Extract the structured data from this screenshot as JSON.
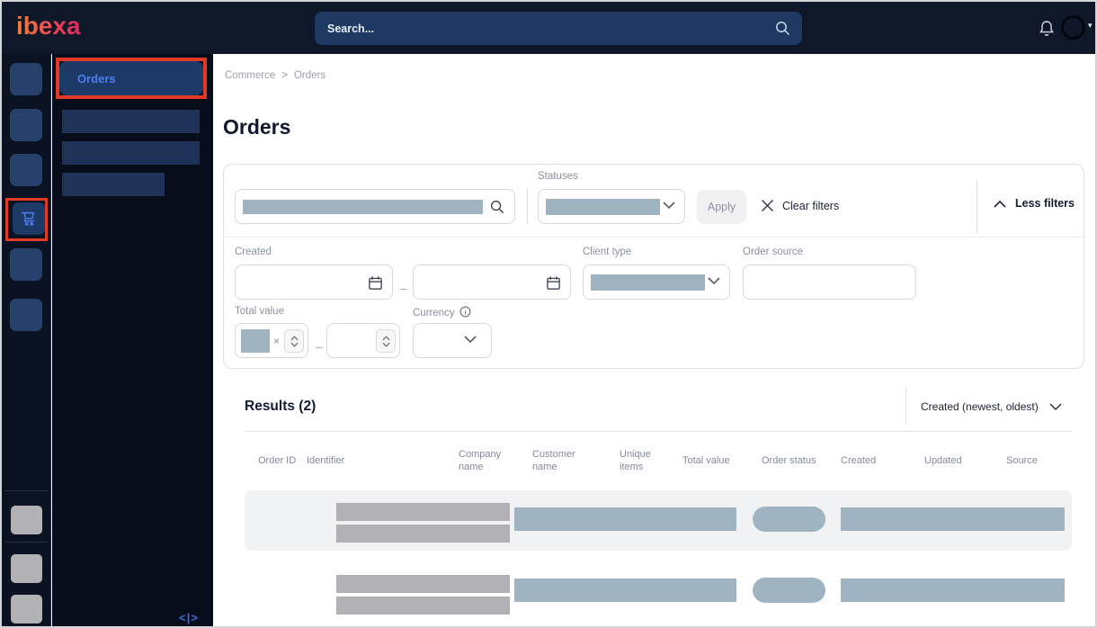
{
  "topbar": {
    "logo": "ibexa",
    "search_placeholder": "Search..."
  },
  "icons": {
    "caret_down_glyph": "▾",
    "collapse_glyph": "<|>"
  },
  "sidebar": {
    "active_item": "Orders"
  },
  "breadcrumb": {
    "items": [
      "Commerce",
      "Orders"
    ],
    "separator": ">"
  },
  "page": {
    "title": "Orders"
  },
  "filters": {
    "statuses_label": "Statuses",
    "apply_label": "Apply",
    "clear_label": "Clear filters",
    "less_label": "Less filters",
    "created_label": "Created",
    "range_separator": "–",
    "client_type_label": "Client type",
    "order_source_label": "Order source",
    "total_value_label": "Total value",
    "currency_label": "Currency",
    "multiply_glyph": "×"
  },
  "results": {
    "title": "Results (2)",
    "count": 2,
    "sort_label": "Created (newest, oldest)",
    "table": {
      "headers": [
        "Order ID",
        "Identifier",
        "Company name",
        "Customer name",
        "Unique items",
        "Total value",
        "Order status",
        "Created",
        "Updated",
        "Source"
      ]
    }
  },
  "colors": {
    "topbar_bg": "#0f1829",
    "rail_bg": "#0b1322",
    "subpanel_bg": "#070d1a",
    "accent_blue": "#4b7df2",
    "annotation_red": "#e23a26",
    "placeholder_bluegray": "#9fb3c1",
    "placeholder_gray": "#b1b1b5",
    "logo_gradient_start": "#f08038",
    "logo_gradient_end": "#d92a5b"
  }
}
